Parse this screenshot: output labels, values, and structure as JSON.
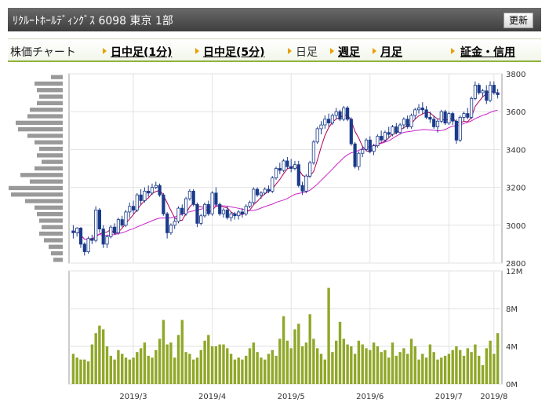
{
  "header": {
    "title": "ﾘｸﾙｰﾄﾎｰﾙﾃﾞｨﾝｸﾞｽ 6098 東京 1部",
    "refresh_label": "更新"
  },
  "tabs": {
    "section_label": "株価チャート",
    "items": [
      {
        "label": "日中足(1分)",
        "active": false
      },
      {
        "label": "日中足(5分)",
        "active": false
      },
      {
        "label": "日足",
        "active": true
      },
      {
        "label": "週足",
        "active": false
      },
      {
        "label": "月足",
        "active": false
      },
      {
        "label": "証金・信用",
        "active": false
      }
    ]
  },
  "colors": {
    "up": "#ffffff",
    "down": "#1a3a8a",
    "ma_short": "#b00058",
    "ma_long": "#cc22cc",
    "volume": "#8fa829",
    "profile": "#999999",
    "tab_arrow": "#e8a000"
  },
  "chart_data": [
    {
      "type": "candlestick",
      "title": "",
      "x_ticks": [
        "2019/3",
        "2019/4",
        "2019/5",
        "2019/6",
        "2019/7",
        "2019/8"
      ],
      "y_ticks": [
        "3800",
        "3600",
        "3400",
        "3200",
        "3000",
        "2800"
      ],
      "ylim": [
        2800,
        3800
      ],
      "grid": true,
      "series": [
        {
          "name": "",
          "type": "ohlc",
          "values": [
            [
              2970,
              3000,
              2930,
              2960
            ],
            [
              2960,
              2990,
              2940,
              2985
            ],
            [
              2985,
              2990,
              2880,
              2900
            ],
            [
              2900,
              2910,
              2840,
              2860
            ],
            [
              2860,
              2940,
              2850,
              2930
            ],
            [
              2930,
              2950,
              2900,
              2920
            ],
            [
              2920,
              3100,
              2910,
              3080
            ],
            [
              3080,
              3090,
              2960,
              2980
            ],
            [
              2980,
              3000,
              2880,
              2900
            ],
            [
              2900,
              2950,
              2880,
              2940
            ],
            [
              2940,
              3000,
              2930,
              2990
            ],
            [
              2990,
              3010,
              2950,
              2960
            ],
            [
              2960,
              3040,
              2950,
              3030
            ],
            [
              3030,
              3050,
              2990,
              3000
            ],
            [
              3000,
              3080,
              2990,
              3070
            ],
            [
              3070,
              3120,
              3040,
              3100
            ],
            [
              3100,
              3130,
              3060,
              3080
            ],
            [
              3080,
              3170,
              3070,
              3160
            ],
            [
              3160,
              3190,
              3110,
              3130
            ],
            [
              3130,
              3200,
              3120,
              3180
            ],
            [
              3180,
              3210,
              3150,
              3170
            ],
            [
              3170,
              3220,
              3160,
              3200
            ],
            [
              3200,
              3230,
              3190,
              3210
            ],
            [
              3210,
              3220,
              3150,
              3160
            ],
            [
              3160,
              3170,
              3050,
              3060
            ],
            [
              3060,
              3070,
              2930,
              2960
            ],
            [
              2960,
              3010,
              2950,
              3000
            ],
            [
              3000,
              3040,
              2980,
              3020
            ],
            [
              3020,
              3100,
              3010,
              3090
            ],
            [
              3090,
              3110,
              3050,
              3060
            ],
            [
              3060,
              3150,
              3050,
              3140
            ],
            [
              3140,
              3190,
              3130,
              3180
            ],
            [
              3180,
              3190,
              3100,
              3110
            ],
            [
              3110,
              3120,
              2990,
              3010
            ],
            [
              3010,
              3060,
              3000,
              3050
            ],
            [
              3050,
              3120,
              3040,
              3110
            ],
            [
              3110,
              3130,
              3050,
              3060
            ],
            [
              3060,
              3180,
              3050,
              3170
            ],
            [
              3170,
              3200,
              3100,
              3110
            ],
            [
              3110,
              3120,
              3050,
              3060
            ],
            [
              3060,
              3090,
              3040,
              3080
            ],
            [
              3080,
              3100,
              3030,
              3040
            ],
            [
              3040,
              3070,
              3020,
              3060
            ],
            [
              3060,
              3070,
              3030,
              3050
            ],
            [
              3050,
              3080,
              3030,
              3070
            ],
            [
              3070,
              3090,
              3040,
              3060
            ],
            [
              3060,
              3110,
              3050,
              3100
            ],
            [
              3100,
              3130,
              3090,
              3120
            ],
            [
              3120,
              3200,
              3110,
              3190
            ],
            [
              3190,
              3200,
              3150,
              3160
            ],
            [
              3160,
              3180,
              3140,
              3170
            ],
            [
              3170,
              3200,
              3160,
              3190
            ],
            [
              3190,
              3210,
              3170,
              3180
            ],
            [
              3180,
              3260,
              3170,
              3250
            ],
            [
              3250,
              3310,
              3240,
              3300
            ],
            [
              3300,
              3330,
              3270,
              3290
            ],
            [
              3290,
              3350,
              3280,
              3340
            ],
            [
              3340,
              3360,
              3300,
              3310
            ],
            [
              3310,
              3350,
              3280,
              3300
            ],
            [
              3300,
              3340,
              3290,
              3320
            ],
            [
              3320,
              3340,
              3200,
              3210
            ],
            [
              3210,
              3230,
              3160,
              3180
            ],
            [
              3180,
              3270,
              3170,
              3260
            ],
            [
              3260,
              3340,
              3250,
              3330
            ],
            [
              3330,
              3450,
              3320,
              3440
            ],
            [
              3440,
              3520,
              3430,
              3510
            ],
            [
              3510,
              3550,
              3480,
              3530
            ],
            [
              3530,
              3580,
              3510,
              3560
            ],
            [
              3560,
              3590,
              3520,
              3540
            ],
            [
              3540,
              3590,
              3530,
              3580
            ],
            [
              3580,
              3620,
              3560,
              3600
            ],
            [
              3600,
              3610,
              3550,
              3560
            ],
            [
              3560,
              3630,
              3550,
              3620
            ],
            [
              3620,
              3630,
              3550,
              3560
            ],
            [
              3560,
              3570,
              3420,
              3430
            ],
            [
              3430,
              3440,
              3300,
              3310
            ],
            [
              3310,
              3390,
              3290,
              3380
            ],
            [
              3380,
              3420,
              3360,
              3400
            ],
            [
              3400,
              3460,
              3390,
              3450
            ],
            [
              3450,
              3470,
              3380,
              3390
            ],
            [
              3390,
              3430,
              3370,
              3420
            ],
            [
              3420,
              3480,
              3410,
              3470
            ],
            [
              3470,
              3500,
              3440,
              3450
            ],
            [
              3450,
              3500,
              3440,
              3490
            ],
            [
              3490,
              3520,
              3460,
              3480
            ],
            [
              3480,
              3530,
              3470,
              3520
            ],
            [
              3520,
              3540,
              3480,
              3490
            ],
            [
              3490,
              3540,
              3480,
              3530
            ],
            [
              3530,
              3570,
              3510,
              3560
            ],
            [
              3560,
              3580,
              3510,
              3520
            ],
            [
              3520,
              3590,
              3510,
              3580
            ],
            [
              3580,
              3620,
              3560,
              3610
            ],
            [
              3610,
              3640,
              3590,
              3620
            ],
            [
              3620,
              3650,
              3590,
              3610
            ],
            [
              3610,
              3630,
              3560,
              3570
            ],
            [
              3570,
              3600,
              3540,
              3560
            ],
            [
              3560,
              3580,
              3510,
              3520
            ],
            [
              3520,
              3560,
              3490,
              3550
            ],
            [
              3550,
              3610,
              3540,
              3600
            ],
            [
              3600,
              3610,
              3530,
              3540
            ],
            [
              3540,
              3600,
              3530,
              3590
            ],
            [
              3590,
              3600,
              3530,
              3550
            ],
            [
              3550,
              3560,
              3430,
              3450
            ],
            [
              3450,
              3580,
              3440,
              3570
            ],
            [
              3570,
              3600,
              3550,
              3590
            ],
            [
              3590,
              3620,
              3560,
              3570
            ],
            [
              3570,
              3680,
              3560,
              3670
            ],
            [
              3670,
              3760,
              3660,
              3740
            ],
            [
              3740,
              3750,
              3690,
              3700
            ],
            [
              3700,
              3720,
              3680,
              3710
            ],
            [
              3710,
              3740,
              3640,
              3660
            ],
            [
              3660,
              3760,
              3650,
              3740
            ],
            [
              3740,
              3760,
              3690,
              3700
            ],
            [
              3700,
              3720,
              3670,
              3690
            ]
          ]
        },
        {
          "name": "",
          "type": "line",
          "role": "ma_short"
        },
        {
          "name": "",
          "type": "line",
          "role": "ma_long"
        }
      ]
    },
    {
      "type": "bar",
      "title": "",
      "y_ticks": [
        "12M",
        "8M",
        "4M",
        "0M"
      ],
      "ylim": [
        0,
        12
      ],
      "grid": true,
      "series": [
        {
          "name": "",
          "values": [
            3.2,
            2.8,
            2.6,
            2.6,
            2.4,
            4.2,
            5.4,
            6.2,
            5.8,
            4.0,
            3.0,
            2.6,
            3.6,
            3.2,
            2.8,
            2.6,
            2.8,
            3.4,
            3.8,
            4.4,
            3.0,
            2.8,
            3.6,
            4.8,
            6.8,
            4.2,
            4.4,
            2.8,
            5.2,
            6.8,
            3.4,
            3.2,
            2.6,
            2.8,
            3.6,
            4.6,
            5.2,
            4.0,
            4.0,
            4.2,
            4.2,
            3.8,
            3.2,
            2.6,
            2.8,
            2.6,
            3.0,
            3.8,
            4.4,
            3.4,
            2.8,
            2.6,
            3.2,
            3.6,
            3.0,
            4.8,
            7.2,
            4.6,
            3.8,
            5.8,
            6.4,
            4.0,
            4.4,
            7.4,
            4.8,
            3.8,
            3.2,
            2.6,
            10.2,
            3.4,
            4.6,
            6.6,
            4.8,
            4.2,
            4.0,
            3.2,
            4.6,
            4.2,
            3.8,
            3.6,
            4.4,
            4.0,
            3.4,
            3.6,
            2.8,
            4.4,
            3.0,
            3.4,
            3.8,
            3.2,
            4.8,
            4.0,
            2.6,
            3.2,
            2.8,
            4.2,
            3.4,
            2.6,
            2.8,
            3.0,
            3.2,
            3.6,
            4.0,
            3.6,
            3.0,
            3.8,
            3.4,
            4.2,
            3.0,
            2.0,
            3.8,
            4.6,
            3.2,
            5.4
          ]
        }
      ]
    }
  ],
  "price_profile": [
    0.25,
    0.6,
    0.55,
    0.5,
    0.55,
    0.7,
    0.75,
    1.0,
    0.95,
    0.75,
    0.6,
    0.5,
    0.55,
    0.45,
    0.6,
    0.9,
    0.7,
    1.15,
    1.1,
    0.8,
    0.6,
    0.55,
    0.5,
    0.45,
    0.5,
    0.4,
    0.3,
    0.25,
    0.2
  ]
}
